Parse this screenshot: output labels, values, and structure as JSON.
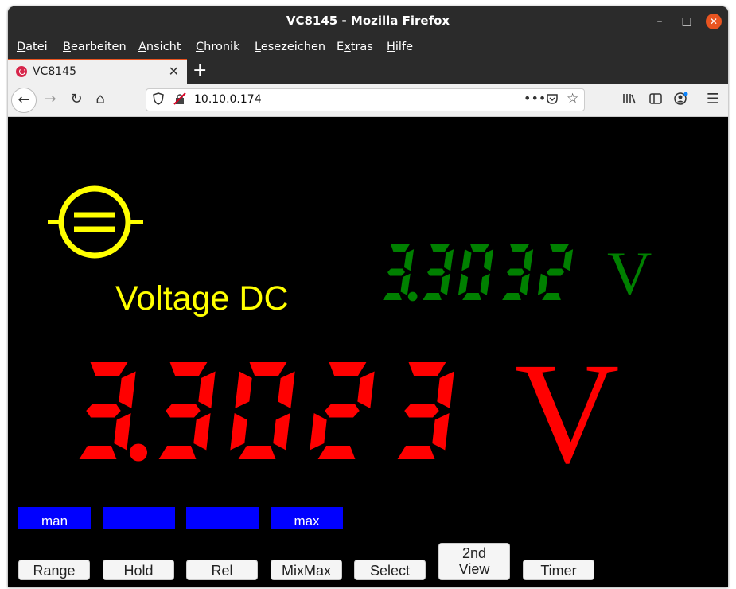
{
  "window": {
    "title": "VC8145 - Mozilla Firefox"
  },
  "menu": [
    {
      "pre": "",
      "u": "D",
      "post": "atei"
    },
    {
      "pre": "",
      "u": "B",
      "post": "earbeiten"
    },
    {
      "pre": "",
      "u": "A",
      "post": "nsicht"
    },
    {
      "pre": "",
      "u": "C",
      "post": "hronik"
    },
    {
      "pre": "",
      "u": "L",
      "post": "esezeichen"
    },
    {
      "pre": "E",
      "u": "x",
      "post": "tras"
    },
    {
      "pre": "",
      "u": "H",
      "post": "ilfe"
    }
  ],
  "tab": {
    "label": "VC8145"
  },
  "address": {
    "url": "10.10.0.174"
  },
  "meter": {
    "mode": "Voltage DC",
    "secondary_value": "3.3032",
    "secondary_unit": "V",
    "primary_value": "3.3023",
    "primary_unit": "V",
    "colors": {
      "symbol": "#ffff00",
      "secondary": "#008000",
      "primary": "#ff0000",
      "indicator": "#0000ff"
    }
  },
  "indicators": [
    "man",
    "",
    "",
    "max"
  ],
  "buttons": [
    "Range",
    "Hold",
    "Rel",
    "MixMax",
    "Select",
    "2nd View",
    "Timer"
  ],
  "button_lines": {
    "second_view_1": "2nd",
    "second_view_2": "View"
  },
  "icons": {
    "tab": "power-icon",
    "back": "back-arrow-icon",
    "forward": "forward-arrow-icon",
    "reload": "reload-icon",
    "home": "home-icon",
    "shield": "shield-icon",
    "insecure": "insecure-lock-icon",
    "more": "more-icon",
    "pocket": "pocket-icon",
    "bookmark": "bookmark-star-icon",
    "library": "library-icon",
    "sidebar": "sidebar-icon",
    "account": "account-icon",
    "menu": "hamburger-menu-icon"
  }
}
